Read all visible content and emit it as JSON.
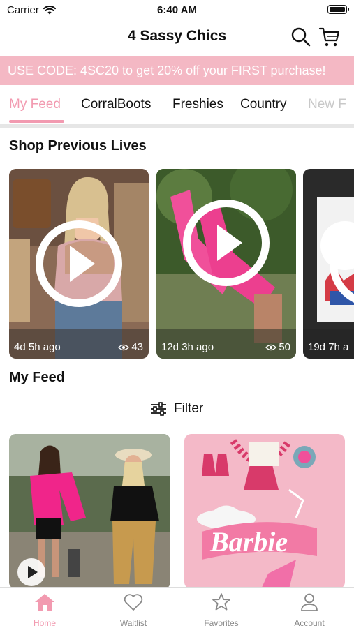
{
  "status_bar": {
    "carrier": "Carrier",
    "time": "6:40 AM"
  },
  "header": {
    "title": "4 Sassy Chics",
    "icons": [
      "search-icon",
      "cart-icon"
    ]
  },
  "promo": {
    "text": "USE CODE: 4SC20 to get 20% off your FIRST purchase!"
  },
  "tabs": [
    "My Feed",
    "CorralBoots",
    "Freshies",
    "Country",
    "New F"
  ],
  "active_tab": "My Feed",
  "sections": {
    "previous_lives": "Shop Previous Lives",
    "feed": "My Feed"
  },
  "lives": [
    {
      "ago": "4d 5h ago",
      "views": "43"
    },
    {
      "ago": "12d 3h ago",
      "views": "50"
    },
    {
      "ago": "19d 7h a",
      "views": ""
    }
  ],
  "filter": {
    "label": "Filter",
    "icon": "sliders-icon"
  },
  "feed_items": [
    {
      "image": "two women in western wear",
      "has_video": true
    },
    {
      "image": "pink Barbie cowboy graphic tee with jewelry",
      "has_video": false
    }
  ],
  "tabbar": [
    {
      "label": "Home",
      "icon": "home-icon",
      "active": true
    },
    {
      "label": "Waitlist",
      "icon": "heart-icon",
      "active": false
    },
    {
      "label": "Favorites",
      "icon": "star-icon",
      "active": false
    },
    {
      "label": "Account",
      "icon": "person-icon",
      "active": false
    }
  ],
  "colors": {
    "accent": "#f29ab0",
    "promo_bg": "#f4b8c4",
    "text": "#111111",
    "muted": "#888888"
  }
}
